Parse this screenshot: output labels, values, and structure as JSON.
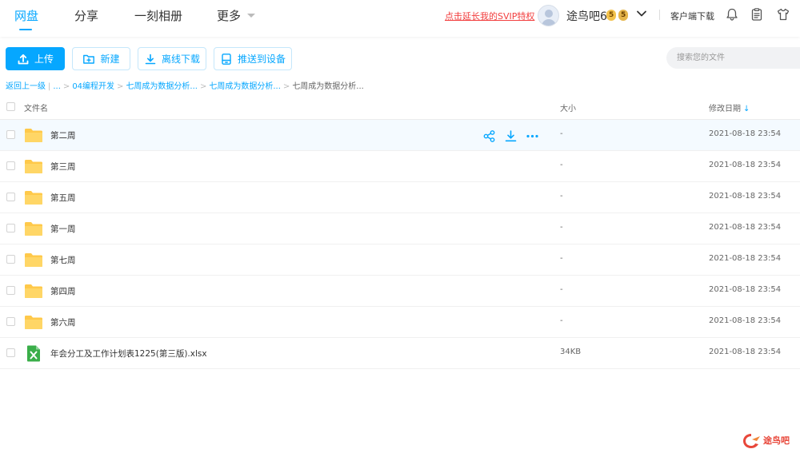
{
  "nav": {
    "tabs": [
      "网盘",
      "分享",
      "一刻相册",
      "更多"
    ],
    "svip_link": "点击延长我的SVIP特权",
    "username": "途鸟吧6",
    "vip_badge": "5",
    "svip_badge": "5",
    "client_download": "客户端下载"
  },
  "toolbar": {
    "upload_label": "上传",
    "new_label": "新建",
    "offline_label": "离线下载",
    "push_label": "推送到设备",
    "search_placeholder": "搜索您的文件"
  },
  "breadcrumb": {
    "back": "返回上一级",
    "ellipsis": "...",
    "items": [
      "04编程开发",
      "七周成为数据分析...",
      "七周成为数据分析..."
    ],
    "current": "七周成为数据分析..."
  },
  "table": {
    "headers": {
      "name": "文件名",
      "size": "大小",
      "date": "修改日期"
    },
    "rows": [
      {
        "name": "第二周",
        "size": "-",
        "date": "2021-08-18 23:54",
        "type": "folder"
      },
      {
        "name": "第三周",
        "size": "-",
        "date": "2021-08-18 23:54",
        "type": "folder"
      },
      {
        "name": "第五周",
        "size": "-",
        "date": "2021-08-18 23:54",
        "type": "folder"
      },
      {
        "name": "第一周",
        "size": "-",
        "date": "2021-08-18 23:54",
        "type": "folder"
      },
      {
        "name": "第七周",
        "size": "-",
        "date": "2021-08-18 23:54",
        "type": "folder"
      },
      {
        "name": "第四周",
        "size": "-",
        "date": "2021-08-18 23:54",
        "type": "folder"
      },
      {
        "name": "第六周",
        "size": "-",
        "date": "2021-08-18 23:54",
        "type": "folder"
      },
      {
        "name": "年会分工及工作计划表1225(第三版).xlsx",
        "size": "34KB",
        "date": "2021-08-18 23:54",
        "type": "xlsx"
      }
    ]
  },
  "watermark": {
    "text": "途鸟吧"
  },
  "colors": {
    "accent": "#06a7ff",
    "folder": "#ffc94a",
    "xlsx": "#3aae49",
    "svip_link": "#f23e3e"
  }
}
